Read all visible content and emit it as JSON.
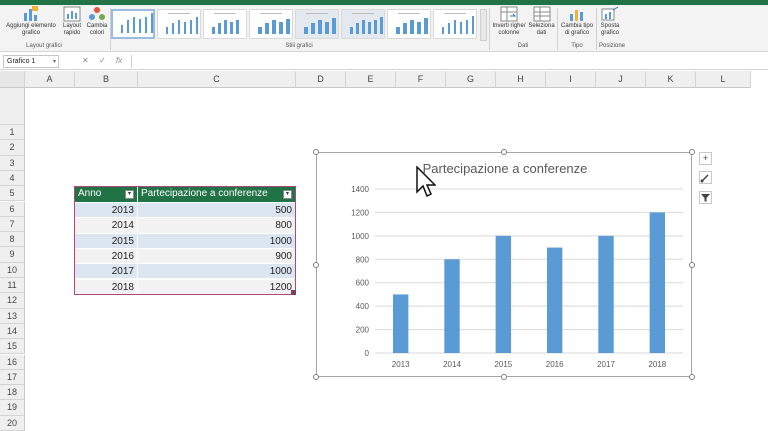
{
  "ribbon": {
    "buttons": {
      "add_element": "Aggiungi elemento grafico",
      "quick_layout": "Layout rapido",
      "change_colors": "Cambia colori",
      "switch_row_col": "Inverti righe/ colonne",
      "select_data": "Seleziona dati",
      "change_type": "Cambia tipo di grafico",
      "move_chart": "Sposta grafico"
    },
    "groups": {
      "layout": "Layout grafici",
      "styles": "Stili grafici",
      "data": "Dati",
      "type": "Tipo",
      "position": "Posizione"
    }
  },
  "formula_bar": {
    "name_box": "Grafico 1",
    "fx": "fx",
    "cancel": "✕",
    "confirm": "✓"
  },
  "grid": {
    "columns": [
      "A",
      "B",
      "C",
      "D",
      "E",
      "F",
      "G",
      "H",
      "I",
      "J",
      "K",
      "L"
    ],
    "rows": [
      "1",
      "2",
      "3",
      "4",
      "5",
      "6",
      "7",
      "8",
      "9",
      "10",
      "11",
      "12",
      "13",
      "14",
      "15",
      "16",
      "17",
      "18",
      "19",
      "20"
    ]
  },
  "table": {
    "headers": [
      "Anno",
      "Partecipazione a conferenze"
    ],
    "rows": [
      [
        "2013",
        "500"
      ],
      [
        "2014",
        "800"
      ],
      [
        "2015",
        "1000"
      ],
      [
        "2016",
        "900"
      ],
      [
        "2017",
        "1000"
      ],
      [
        "2018",
        "1200"
      ]
    ]
  },
  "chart_data": {
    "type": "bar",
    "title": "Partecipazione a conferenze",
    "categories": [
      "2013",
      "2014",
      "2015",
      "2016",
      "2017",
      "2018"
    ],
    "values": [
      500,
      800,
      1000,
      900,
      1000,
      1200
    ],
    "ylim": [
      0,
      1400
    ],
    "yticks": [
      "0",
      "200",
      "400",
      "600",
      "800",
      "1000",
      "1200",
      "1400"
    ],
    "grid": true,
    "bar_color": "#5b9bd5"
  },
  "chart_side_buttons": [
    "+",
    "🖌",
    "▼"
  ]
}
